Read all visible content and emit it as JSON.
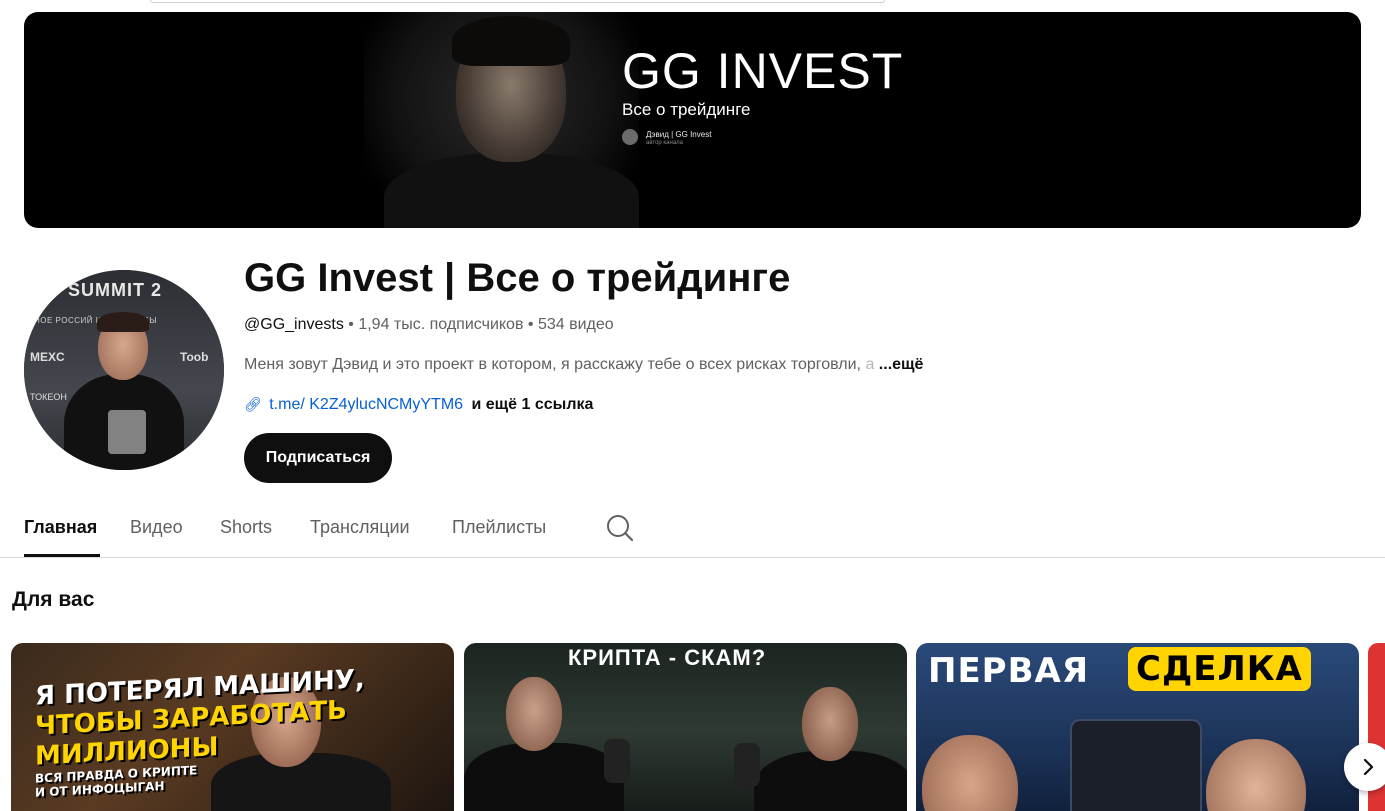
{
  "banner": {
    "title": "GG INVEST",
    "subtitle": "Все о трейдинге",
    "author": "Дэвид | GG Invest",
    "author_role": "автор канала"
  },
  "avatar": {
    "summit_text": "SUMMIT 2",
    "line_text": "НОЕ РОССИЙ    КРИПТОСОБЫ",
    "logo_left": "MEXC",
    "logo_right": "Toob",
    "logo_bottom": "ТОКЕОН"
  },
  "channel": {
    "title": "GG Invest | Все о трейдинге",
    "handle": "@GG_invests",
    "subscribers": "1,94 тыс. подписчиков",
    "videos": "534 видео",
    "description": "Меня зовут Дэвид и это проект в котором, я расскажу тебе о всех рисках торговли,",
    "description_faded": " а",
    "description_more": "...ещё",
    "link_text": "t.me/ K2Z4ylucNCMyYTM6",
    "more_links": "и ещё 1 ссылка",
    "subscribe_label": "Подписаться"
  },
  "tabs": [
    {
      "label": "Главная"
    },
    {
      "label": "Видео"
    },
    {
      "label": "Shorts"
    },
    {
      "label": "Трансляции"
    },
    {
      "label": "Плейлисты"
    }
  ],
  "section": {
    "title": "Для вас"
  },
  "thumbnails": [
    {
      "line1": "Я ПОТЕРЯЛ МАШИНУ,",
      "line2": "ЧТОБЫ ЗАРАБОТАТЬ",
      "line3": "МИЛЛИОНЫ",
      "small1": "ВСЯ ПРАВДА О КРИПТЕ",
      "small2": "И ОТ ИНФОЦЫГАН"
    },
    {
      "title": "КРИПТА - СКАМ?"
    },
    {
      "label1": "ПЕРВАЯ",
      "label2": "СДЕЛКА"
    }
  ],
  "colors": {
    "link": "#065fd4",
    "subscribe_bg": "#0f0f0f",
    "accent_yellow": "#ffd400"
  }
}
